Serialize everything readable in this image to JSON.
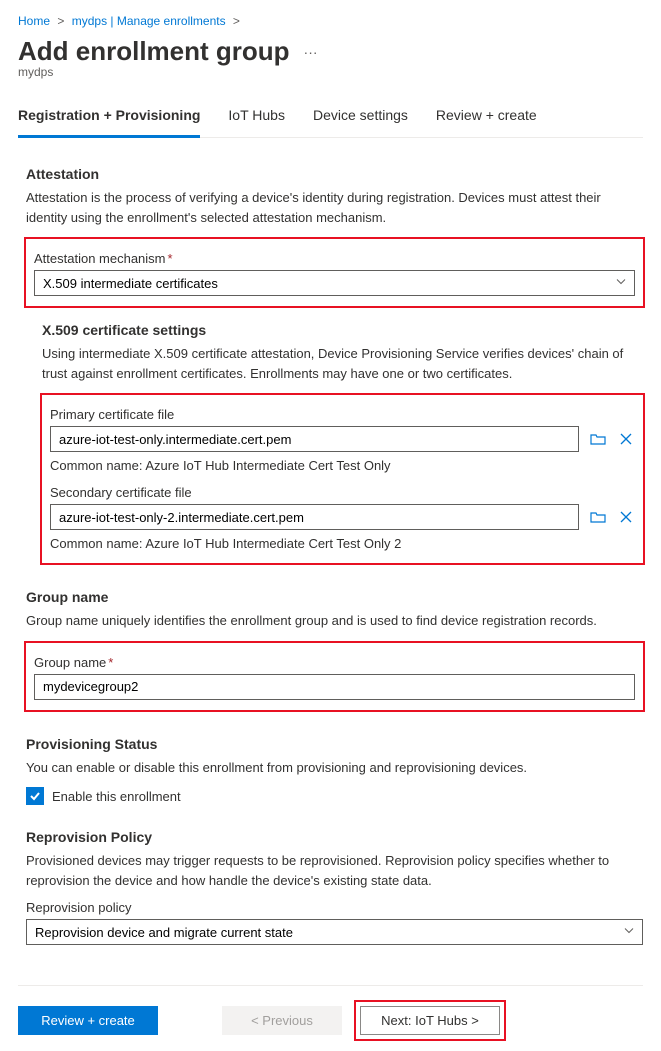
{
  "breadcrumb": {
    "items": [
      {
        "label": "Home"
      },
      {
        "label": "mydps | Manage enrollments"
      }
    ]
  },
  "page": {
    "title": "Add enrollment group",
    "subtitle": "mydps"
  },
  "tabs": [
    {
      "label": "Registration + Provisioning",
      "active": true
    },
    {
      "label": "IoT Hubs"
    },
    {
      "label": "Device settings"
    },
    {
      "label": "Review + create"
    }
  ],
  "attestation": {
    "heading": "Attestation",
    "desc": "Attestation is the process of verifying a device's identity during registration. Devices must attest their identity using the enrollment's selected attestation mechanism.",
    "mechanism_label": "Attestation mechanism",
    "mechanism_value": "X.509 intermediate certificates"
  },
  "certs": {
    "heading": "X.509 certificate settings",
    "desc": "Using intermediate X.509 certificate attestation, Device Provisioning Service verifies devices' chain of trust against enrollment certificates. Enrollments may have one or two certificates.",
    "primary_label": "Primary certificate file",
    "primary_value": "azure-iot-test-only.intermediate.cert.pem",
    "primary_cn": "Common name: Azure IoT Hub Intermediate Cert Test Only",
    "secondary_label": "Secondary certificate file",
    "secondary_value": "azure-iot-test-only-2.intermediate.cert.pem",
    "secondary_cn": "Common name: Azure IoT Hub Intermediate Cert Test Only 2"
  },
  "group": {
    "heading": "Group name",
    "desc": "Group name uniquely identifies the enrollment group and is used to find device registration records.",
    "label": "Group name",
    "value": "mydevicegroup2"
  },
  "provisioning": {
    "heading": "Provisioning Status",
    "desc": "You can enable or disable this enrollment from provisioning and reprovisioning devices.",
    "checkbox_label": "Enable this enrollment"
  },
  "reprovision": {
    "heading": "Reprovision Policy",
    "desc": "Provisioned devices may trigger requests to be reprovisioned. Reprovision policy specifies whether to reprovision the device and how handle the device's existing state data.",
    "label": "Reprovision policy",
    "value": "Reprovision device and migrate current state"
  },
  "footer": {
    "review": "Review + create",
    "previous": "< Previous",
    "next": "Next: IoT Hubs >"
  }
}
